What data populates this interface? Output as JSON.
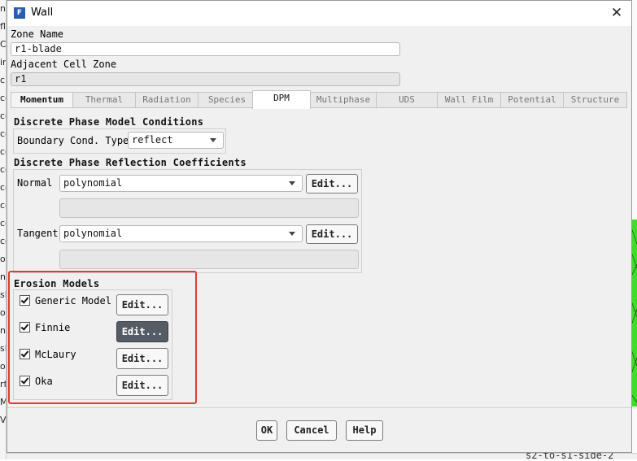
{
  "window": {
    "title": "Wall",
    "icon": "fluent-app-icon",
    "close": "✕"
  },
  "zone_name": {
    "label": "Zone Name",
    "value": "r1-blade"
  },
  "adjacent_cell_zone": {
    "label": "Adjacent Cell Zone",
    "value": "r1"
  },
  "tabs": [
    {
      "label": "Momentum",
      "active": false
    },
    {
      "label": "Thermal",
      "active": false
    },
    {
      "label": "Radiation",
      "active": false
    },
    {
      "label": "Species",
      "active": false
    },
    {
      "label": "DPM",
      "active": true
    },
    {
      "label": "Multiphase",
      "active": false
    },
    {
      "label": "UDS",
      "active": false
    },
    {
      "label": "Wall Film",
      "active": false
    },
    {
      "label": "Potential",
      "active": false
    },
    {
      "label": "Structure",
      "active": false
    }
  ],
  "dpm_conditions": {
    "title": "Discrete Phase Model Conditions",
    "boundary_label": "Boundary Cond. Type",
    "boundary_value": "reflect"
  },
  "reflection": {
    "title": "Discrete Phase Reflection Coefficients",
    "normal_label": "Normal",
    "normal_value": "polynomial",
    "tangent_label": "Tangent",
    "tangent_value": "polynomial",
    "edit_label": "Edit..."
  },
  "erosion": {
    "title": "Erosion Models",
    "models": [
      {
        "label": "Generic Model",
        "checked": true,
        "edit": "Edit..."
      },
      {
        "label": "Finnie",
        "checked": true,
        "edit": "Edit..."
      },
      {
        "label": "McLaury",
        "checked": true,
        "edit": "Edit..."
      },
      {
        "label": "Oka",
        "checked": true,
        "edit": "Edit..."
      }
    ]
  },
  "footer": {
    "ok": "OK",
    "cancel": "Cancel",
    "help": "Help"
  },
  "background": {
    "left_fragments": [
      "n",
      "fl",
      "C",
      "in",
      "cl",
      "co",
      "co",
      "co",
      "co",
      "co",
      "co",
      "co",
      "co",
      "co",
      "ol",
      "n",
      "sh",
      "ol",
      "n",
      "sh",
      "ol",
      "rf",
      "M",
      "V"
    ],
    "bottom_text": "s2-to-s1-side-2"
  },
  "colors": {
    "highlight": "#e53935",
    "accent_button": "#555c66",
    "mesh_green": "#3fdc2a"
  }
}
